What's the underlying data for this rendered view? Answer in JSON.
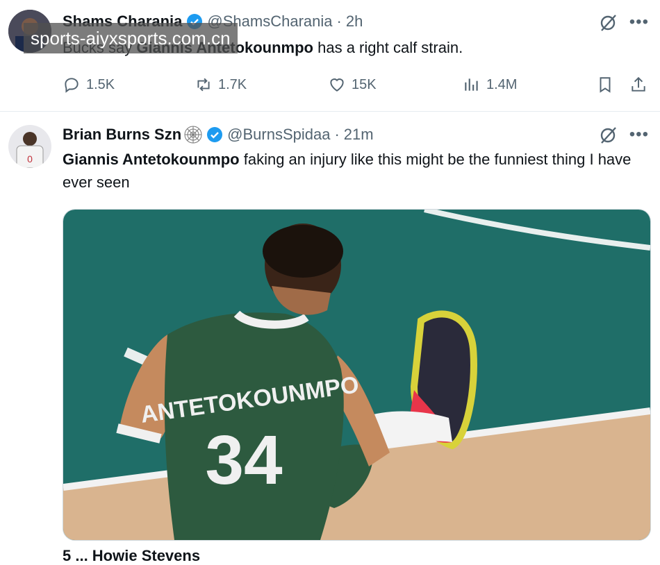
{
  "watermark": "sports-aiyxsports.com.cn",
  "tweet1": {
    "name": "Shams Charania",
    "handle": "@ShamsCharania",
    "time": "2h",
    "text_prefix": "Bucks say ",
    "text_bold": "Giannis Antetokounmpo",
    "text_suffix": " has a right calf strain.",
    "replies": "1.5K",
    "retweets": "1.7K",
    "likes": "15K",
    "views": "1.4M"
  },
  "tweet2": {
    "name": "Brian Burns Szn",
    "handle": "@BurnsSpidaa",
    "time": "21m",
    "text_bold": "Giannis Antetokounmpo",
    "text_rest": " faking an injury like this might be the funniest thing I have ever seen",
    "jersey_name": "ANTETOKOUNMPO",
    "jersey_number": "34"
  },
  "footer_partial": "5 ... Howie Stevens",
  "colors": {
    "verified": "#1d9bf0",
    "court": "#1f6e68",
    "jersey": "#2d5a3f"
  },
  "icons": [
    "grok-icon",
    "more-icon",
    "reply-icon",
    "retweet-icon",
    "like-icon",
    "views-icon",
    "bookmark-icon",
    "share-icon",
    "verified-icon",
    "cobweb-icon"
  ]
}
